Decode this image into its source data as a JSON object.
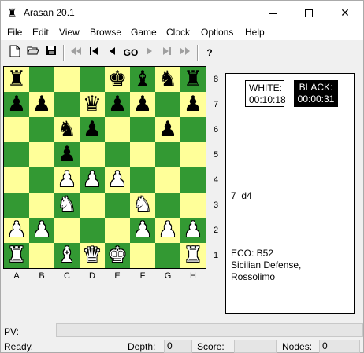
{
  "window": {
    "title": "Arasan 20.1",
    "icon": "rook-icon"
  },
  "menu": [
    "File",
    "Edit",
    "View",
    "Browse",
    "Game",
    "Clock",
    "Options",
    "Help"
  ],
  "toolbar": {
    "buttons": [
      {
        "icon": "new-document-icon",
        "glyph": "🗋",
        "enabled": true
      },
      {
        "icon": "open-folder-icon",
        "glyph": "📂",
        "enabled": true
      },
      {
        "icon": "save-disk-icon",
        "glyph": "💾",
        "enabled": true
      },
      {
        "icon": "fast-back-icon",
        "glyph": "◀◀",
        "enabled": false
      },
      {
        "icon": "go-start-icon",
        "glyph": "⏮",
        "enabled": true
      },
      {
        "icon": "back-icon",
        "glyph": "◀",
        "enabled": true
      },
      {
        "icon": "go-icon",
        "glyph": "GO",
        "enabled": true
      },
      {
        "icon": "forward-icon",
        "glyph": "▶",
        "enabled": false
      },
      {
        "icon": "go-end-icon",
        "glyph": "⏭",
        "enabled": false
      },
      {
        "icon": "fast-forward-icon",
        "glyph": "▶▶",
        "enabled": false
      },
      {
        "icon": "hint-icon",
        "glyph": "?",
        "enabled": true
      }
    ]
  },
  "board": {
    "ranks": [
      "8",
      "7",
      "6",
      "5",
      "4",
      "3",
      "2",
      "1"
    ],
    "files": [
      "A",
      "B",
      "C",
      "D",
      "E",
      "F",
      "G",
      "H"
    ],
    "rows": [
      [
        "r",
        "",
        "",
        "",
        "k",
        "b",
        "n",
        "r"
      ],
      [
        "p",
        "p",
        "",
        "q",
        "p",
        "p",
        "",
        "p"
      ],
      [
        "",
        "",
        "n",
        "p",
        "",
        "",
        "p",
        ""
      ],
      [
        "",
        "",
        "p",
        "",
        "",
        "",
        "",
        ""
      ],
      [
        "",
        "",
        "P",
        "P",
        "P",
        "",
        "",
        ""
      ],
      [
        "",
        "",
        "N",
        "",
        "",
        "N",
        "",
        ""
      ],
      [
        "P",
        "P",
        "",
        "",
        "",
        "P",
        "P",
        "P"
      ],
      [
        "R",
        "",
        "B",
        "Q",
        "K",
        "",
        "",
        "R"
      ]
    ]
  },
  "clocks": {
    "white_label": "WHITE:",
    "white_time": "00:10:18",
    "black_label": "BLACK:",
    "black_time": "00:00:31"
  },
  "info": {
    "last_move": "7  d4",
    "eco_code": "ECO: B52",
    "opening_line1": "Sicilian Defense,",
    "opening_line2": "Rossolimo"
  },
  "pv": {
    "label": "PV:",
    "value": ""
  },
  "status": {
    "message": "Ready.",
    "depth_label": "Depth:",
    "depth_value": "0",
    "score_label": "Score:",
    "score_value": "",
    "nodes_label": "Nodes:",
    "nodes_value": "0"
  },
  "colors": {
    "light_square": "#ffff99",
    "dark_square": "#339933"
  }
}
